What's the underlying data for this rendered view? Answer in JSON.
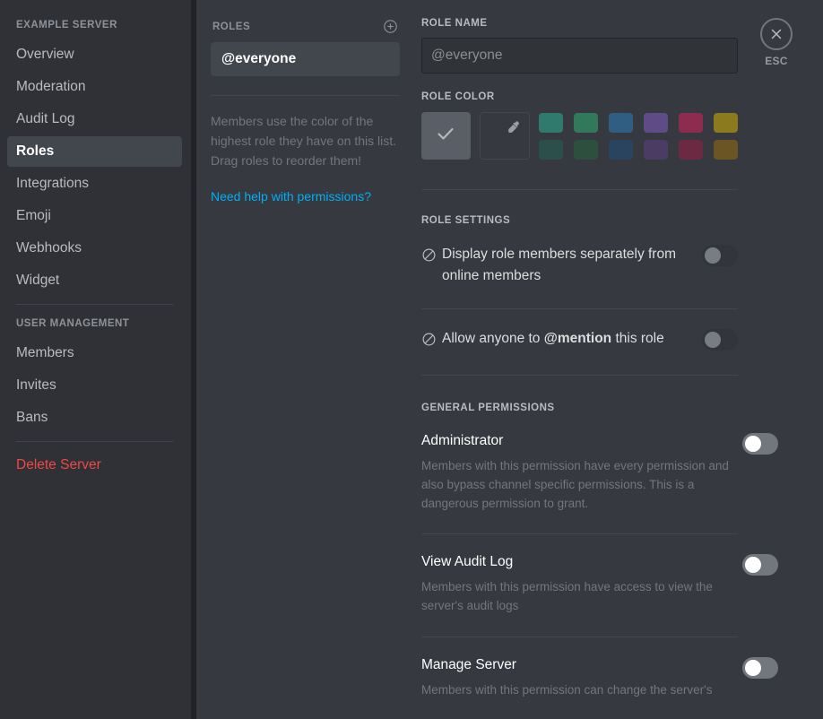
{
  "sidebar": {
    "server_header": "EXAMPLE SERVER",
    "items": [
      {
        "label": "Overview",
        "active": false
      },
      {
        "label": "Moderation",
        "active": false
      },
      {
        "label": "Audit Log",
        "active": false
      },
      {
        "label": "Roles",
        "active": true
      },
      {
        "label": "Integrations",
        "active": false
      },
      {
        "label": "Emoji",
        "active": false
      },
      {
        "label": "Webhooks",
        "active": false
      },
      {
        "label": "Widget",
        "active": false
      }
    ],
    "user_management_header": "USER MANAGEMENT",
    "user_items": [
      {
        "label": "Members"
      },
      {
        "label": "Invites"
      },
      {
        "label": "Bans"
      }
    ],
    "delete_server": "Delete Server"
  },
  "roles_panel": {
    "header": "ROLES",
    "add_icon": "plus-circle-icon",
    "selected_role": "@everyone",
    "note": "Members use the color of the highest role they have on this list. Drag roles to reorder them!",
    "help_link": "Need help with permissions?"
  },
  "role_editor": {
    "role_name_label": "ROLE NAME",
    "role_name_value": "@everyone",
    "role_color_label": "ROLE COLOR",
    "default_swatch_icon": "check-icon",
    "custom_swatch_icon": "eyedropper-icon",
    "palette": [
      "#2f7a6d",
      "#31795a",
      "#2f5e82",
      "#5f4c86",
      "#8e2c4f",
      "#8b7a1e",
      "#2c4f4c",
      "#2d4f3d",
      "#2a4460",
      "#4a3c63",
      "#6b2a42",
      "#6b5524"
    ],
    "role_settings_label": "ROLE SETTINGS",
    "settings": [
      {
        "icon": "deny-icon",
        "label": "Display role members separately from online members",
        "toggle_state": "off",
        "toggle_disabled": true
      },
      {
        "icon": "deny-icon",
        "label_prefix": "Allow anyone to ",
        "label_strong": "@mention",
        "label_suffix": " this role",
        "toggle_state": "off",
        "toggle_disabled": true
      }
    ],
    "general_permissions_label": "GENERAL PERMISSIONS",
    "permissions": [
      {
        "title": "Administrator",
        "description": "Members with this permission have every permission and also bypass channel specific permissions. This is a dangerous permission to grant.",
        "toggle_state": "off",
        "toggle_disabled": false
      },
      {
        "title": "View Audit Log",
        "description": "Members with this permission have access to view the server's audit logs",
        "toggle_state": "off",
        "toggle_disabled": false
      },
      {
        "title": "Manage Server",
        "description": "Members with this permission can change the server's",
        "toggle_state": "off",
        "toggle_disabled": false
      }
    ]
  },
  "close": {
    "icon": "close-x-icon",
    "label": "ESC"
  }
}
